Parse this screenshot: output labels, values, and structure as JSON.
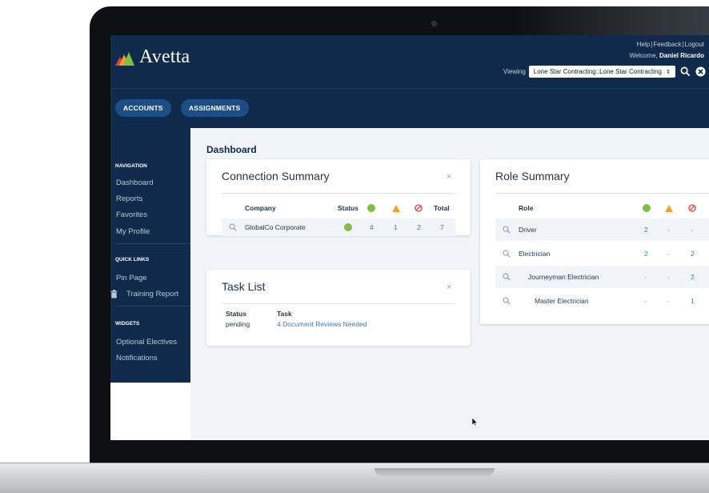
{
  "colors": {
    "header_bg": "#0f2a4b",
    "nav_button": "#1c4e86",
    "content_bg": "#f1f4f8",
    "link": "#3e7cc4",
    "status_green": "#7dc144",
    "status_orange": "#f2a22b",
    "status_red": "#e0413b"
  },
  "header": {
    "brand": "Avetta",
    "links": {
      "help": "Help",
      "feedback": "Feedback",
      "logout": "Logout",
      "separator": "|"
    },
    "welcome_prefix": "Welcome,",
    "user_name": "Daniel Ricardo",
    "viewing_label": "Viewing",
    "viewing_value": "Lone Star Contracting::Lone Star Contracting",
    "viewing_caret": "⇕"
  },
  "nav": {
    "accounts": "ACCOUNTS",
    "assignments": "ASSIGNMENTS"
  },
  "sidebar": {
    "navigation_heading": "NAVIGATION",
    "navigation": [
      "Dashboard",
      "Reports",
      "Favorites",
      "My Profile"
    ],
    "quick_links_heading": "QUICK LINKS",
    "quick_links": [
      "Pin Page",
      "Training Report"
    ],
    "widgets_heading": "WIDGETS",
    "widgets": [
      "Optional Electives",
      "Notifications"
    ]
  },
  "page": {
    "title": "Dashboard"
  },
  "connection_summary": {
    "title": "Connection Summary",
    "close": "×",
    "headers": {
      "company": "Company",
      "status": "Status",
      "total": "Total"
    },
    "rows": [
      {
        "company": "GlobalCo Corporate",
        "green": "4",
        "orange": "1",
        "red": "2",
        "total": "7"
      }
    ]
  },
  "task_list": {
    "title": "Task List",
    "close": "×",
    "headers": {
      "status": "Status",
      "task": "Task"
    },
    "rows": [
      {
        "status": "pending",
        "task": "4 Document Reviews Needed"
      }
    ]
  },
  "role_summary": {
    "title": "Role Summary",
    "headers": {
      "role": "Role"
    },
    "rows": [
      {
        "role": "Driver",
        "green": "2",
        "orange": "-",
        "red": "-"
      },
      {
        "role": "Electrician",
        "green": "2",
        "orange": "-",
        "red": "2"
      },
      {
        "role": "Journeyman Electrician",
        "green": "-",
        "orange": "-",
        "red": "2"
      },
      {
        "role": "Master Electrician",
        "green": "-",
        "orange": "-",
        "red": "1"
      }
    ]
  }
}
